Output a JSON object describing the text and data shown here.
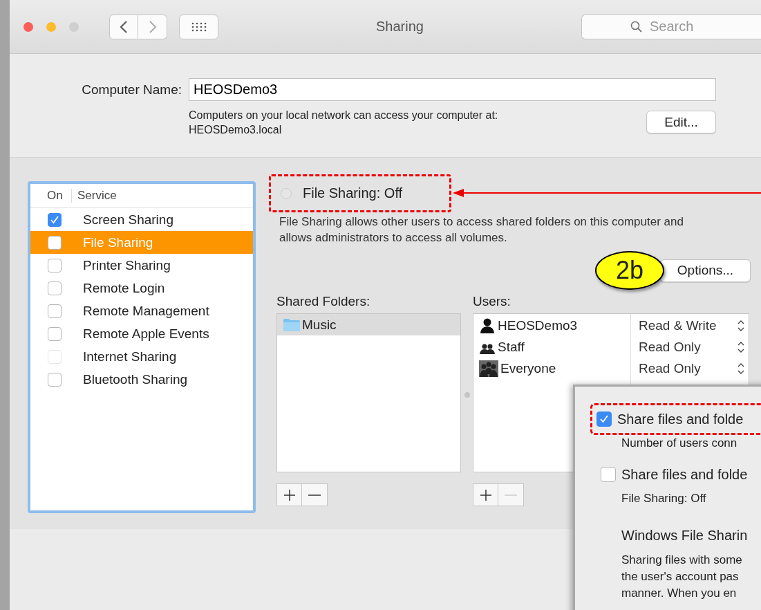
{
  "window": {
    "title": "Sharing"
  },
  "search": {
    "placeholder": "Search"
  },
  "computer_name": {
    "label": "Computer Name:",
    "value": "HEOSDemo3",
    "note": "Computers on your local network can access your computer at:",
    "address": "HEOSDemo3.local",
    "edit_button": "Edit..."
  },
  "services": {
    "columns": [
      "On",
      "Service"
    ],
    "items": [
      {
        "name": "Screen Sharing",
        "checked": true,
        "selected": false,
        "disabled": false
      },
      {
        "name": "File Sharing",
        "checked": false,
        "selected": true,
        "disabled": false
      },
      {
        "name": "Printer Sharing",
        "checked": false,
        "selected": false,
        "disabled": false
      },
      {
        "name": "Remote Login",
        "checked": false,
        "selected": false,
        "disabled": false
      },
      {
        "name": "Remote Management",
        "checked": false,
        "selected": false,
        "disabled": false
      },
      {
        "name": "Remote Apple Events",
        "checked": false,
        "selected": false,
        "disabled": false
      },
      {
        "name": "Internet Sharing",
        "checked": false,
        "selected": false,
        "disabled": true
      },
      {
        "name": "Bluetooth Sharing",
        "checked": false,
        "selected": false,
        "disabled": false
      }
    ]
  },
  "status": {
    "label": "File Sharing: Off",
    "on": false
  },
  "description": "File Sharing allows other users to access shared folders on this computer and allows administrators to access all volumes.",
  "options_button": "Options...",
  "callout": "2b",
  "shared_folders": {
    "label": "Shared Folders:",
    "items": [
      {
        "name": "Music",
        "selected": true
      }
    ],
    "remove_disabled": false
  },
  "users": {
    "label": "Users:",
    "items": [
      {
        "name": "HEOSDemo3",
        "kind": "user",
        "permission": "Read & Write"
      },
      {
        "name": "Staff",
        "kind": "group",
        "permission": "Read Only"
      },
      {
        "name": "Everyone",
        "kind": "everyone",
        "permission": "Read Only"
      }
    ],
    "remove_disabled": true
  },
  "options_dialog": {
    "options": [
      {
        "label": "Share files and folde",
        "checked": true,
        "note": "Number of users conn",
        "highlighted": true
      },
      {
        "label": "Share files and folde",
        "checked": false,
        "note": "File Sharing: Off",
        "highlighted": false
      }
    ],
    "heading": "Windows File Sharin",
    "text_lines": [
      "Sharing files with some",
      "the user's account pas",
      "manner.  When you en"
    ]
  }
}
